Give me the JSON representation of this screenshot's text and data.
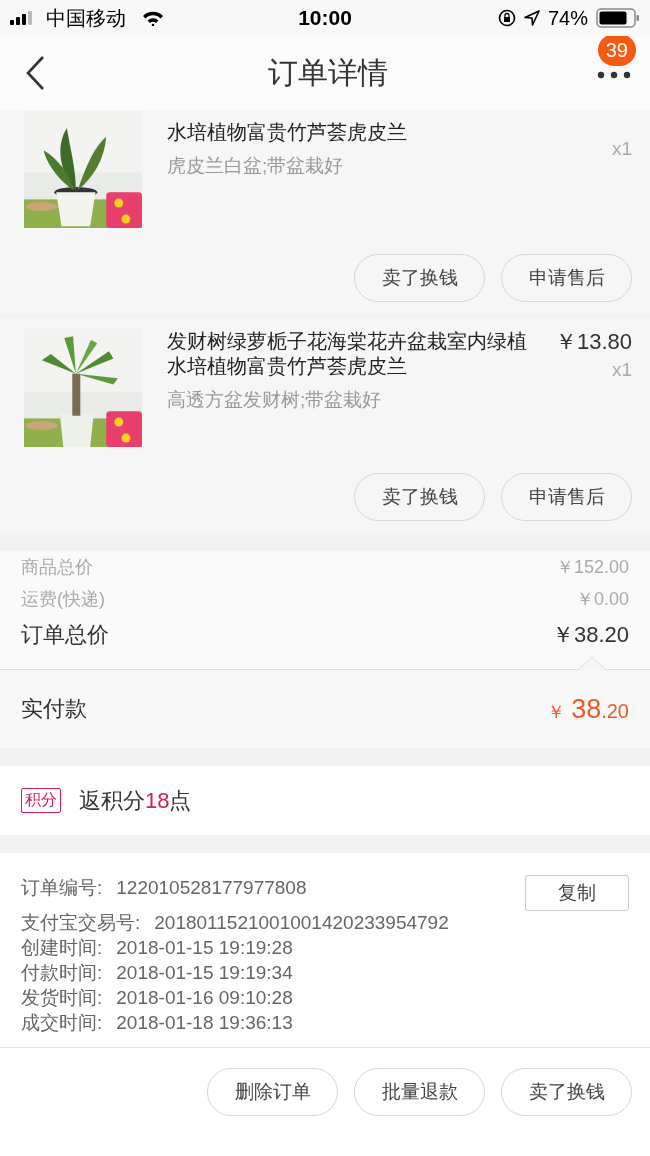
{
  "status_bar": {
    "carrier": "中国移动",
    "time": "10:00",
    "battery": "74%"
  },
  "nav": {
    "title": "订单详情",
    "badge": "39"
  },
  "products": [
    {
      "title": "水培植物富贵竹芦荟虎皮兰",
      "spec": "虎皮兰白盆;带盆栽好",
      "qty": "x1",
      "buttons": [
        "卖了换钱",
        "申请售后"
      ]
    },
    {
      "title": "发财树绿萝栀子花海棠花卉盆栽室内绿植水培植物富贵竹芦荟虎皮兰",
      "spec": "高透方盆发财树;带盆栽好",
      "price": "￥13.80",
      "qty": "x1",
      "buttons": [
        "卖了换钱",
        "申请售后"
      ]
    }
  ],
  "summary": {
    "rows": [
      {
        "label": "商品总价",
        "value": "￥152.00",
        "kind": "minor"
      },
      {
        "label": "运费(快递)",
        "value": "￥0.00",
        "kind": "minor"
      },
      {
        "label": "订单总价",
        "value": "￥38.20",
        "kind": "total"
      }
    ],
    "paid": {
      "label": "实付款",
      "currency": "￥",
      "main": "38",
      "cents": ".20"
    }
  },
  "points": {
    "tag": "积分",
    "prefix": "返积分",
    "number": "18",
    "suffix": "点"
  },
  "order_info": {
    "rows": [
      {
        "label": "订单编号:",
        "value": "122010528177977808"
      },
      {
        "label": "支付宝交易号:",
        "value": "2018011521001001420233954792"
      },
      {
        "label": "创建时间:",
        "value": "2018-01-15 19:19:28"
      },
      {
        "label": "付款时间:",
        "value": "2018-01-15 19:19:34"
      },
      {
        "label": "发货时间:",
        "value": "2018-01-16 09:10:28"
      },
      {
        "label": "成交时间:",
        "value": "2018-01-18 19:36:13"
      }
    ],
    "copy_button": "复制"
  },
  "footer_buttons": [
    "删除订单",
    "批量退款",
    "卖了换钱"
  ]
}
